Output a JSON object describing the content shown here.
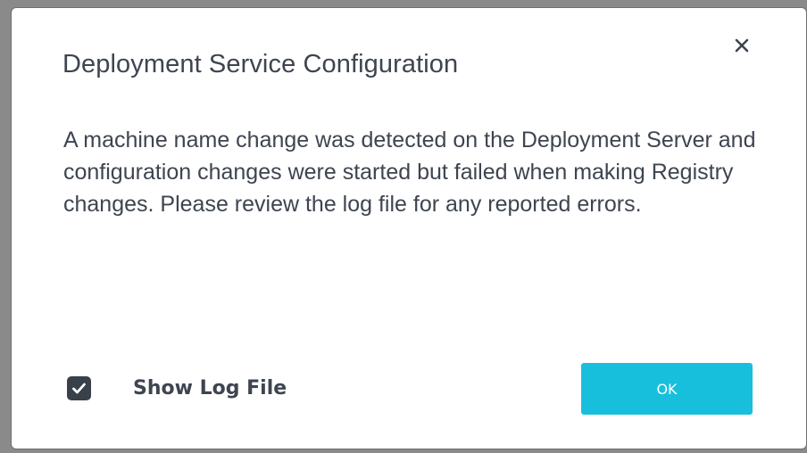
{
  "dialog": {
    "title": "Deployment Service Configuration",
    "message": "A machine name change was detected on the Deployment Server and configuration changes were started but failed when making Registry changes. Please review the log file for any reported errors.",
    "close_icon": "close-icon",
    "show_log_file": {
      "label": "Show Log File",
      "checked": true,
      "icon": "checkmark-icon"
    },
    "ok_label": "OK"
  },
  "colors": {
    "text": "#3e4550",
    "accent": "#18bfdc",
    "checkbox": "#38404a"
  }
}
